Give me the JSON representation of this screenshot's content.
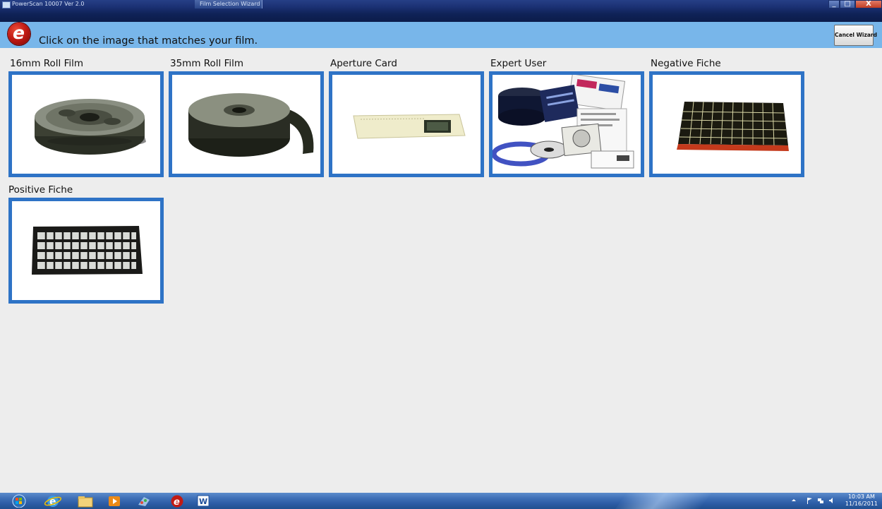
{
  "titlebar": {
    "app_title": "PowerScan 10007 Ver 2.0",
    "window_title": "Film Selection Wizard",
    "close_glyph": "X"
  },
  "header": {
    "instruction": "Click on the image that matches your film.",
    "cancel_label": "Cancel Wizard",
    "logo_letter": "e"
  },
  "tiles": [
    {
      "label": "16mm Roll Film",
      "icon": "film-reel-16mm-icon"
    },
    {
      "label": "35mm Roll Film",
      "icon": "film-reel-35mm-icon"
    },
    {
      "label": "Aperture Card",
      "icon": "aperture-card-icon"
    },
    {
      "label": "Expert User",
      "icon": "expert-user-collage-icon"
    },
    {
      "label": "Negative Fiche",
      "icon": "negative-fiche-icon"
    },
    {
      "label": "Positive Fiche",
      "icon": "positive-fiche-icon"
    }
  ],
  "taskbar": {
    "time": "10:03 AM",
    "date": "11/16/2011"
  },
  "colors": {
    "header_bg": "#78b6ea",
    "tile_border": "#2e73c6",
    "logo_red": "#c21b14"
  }
}
